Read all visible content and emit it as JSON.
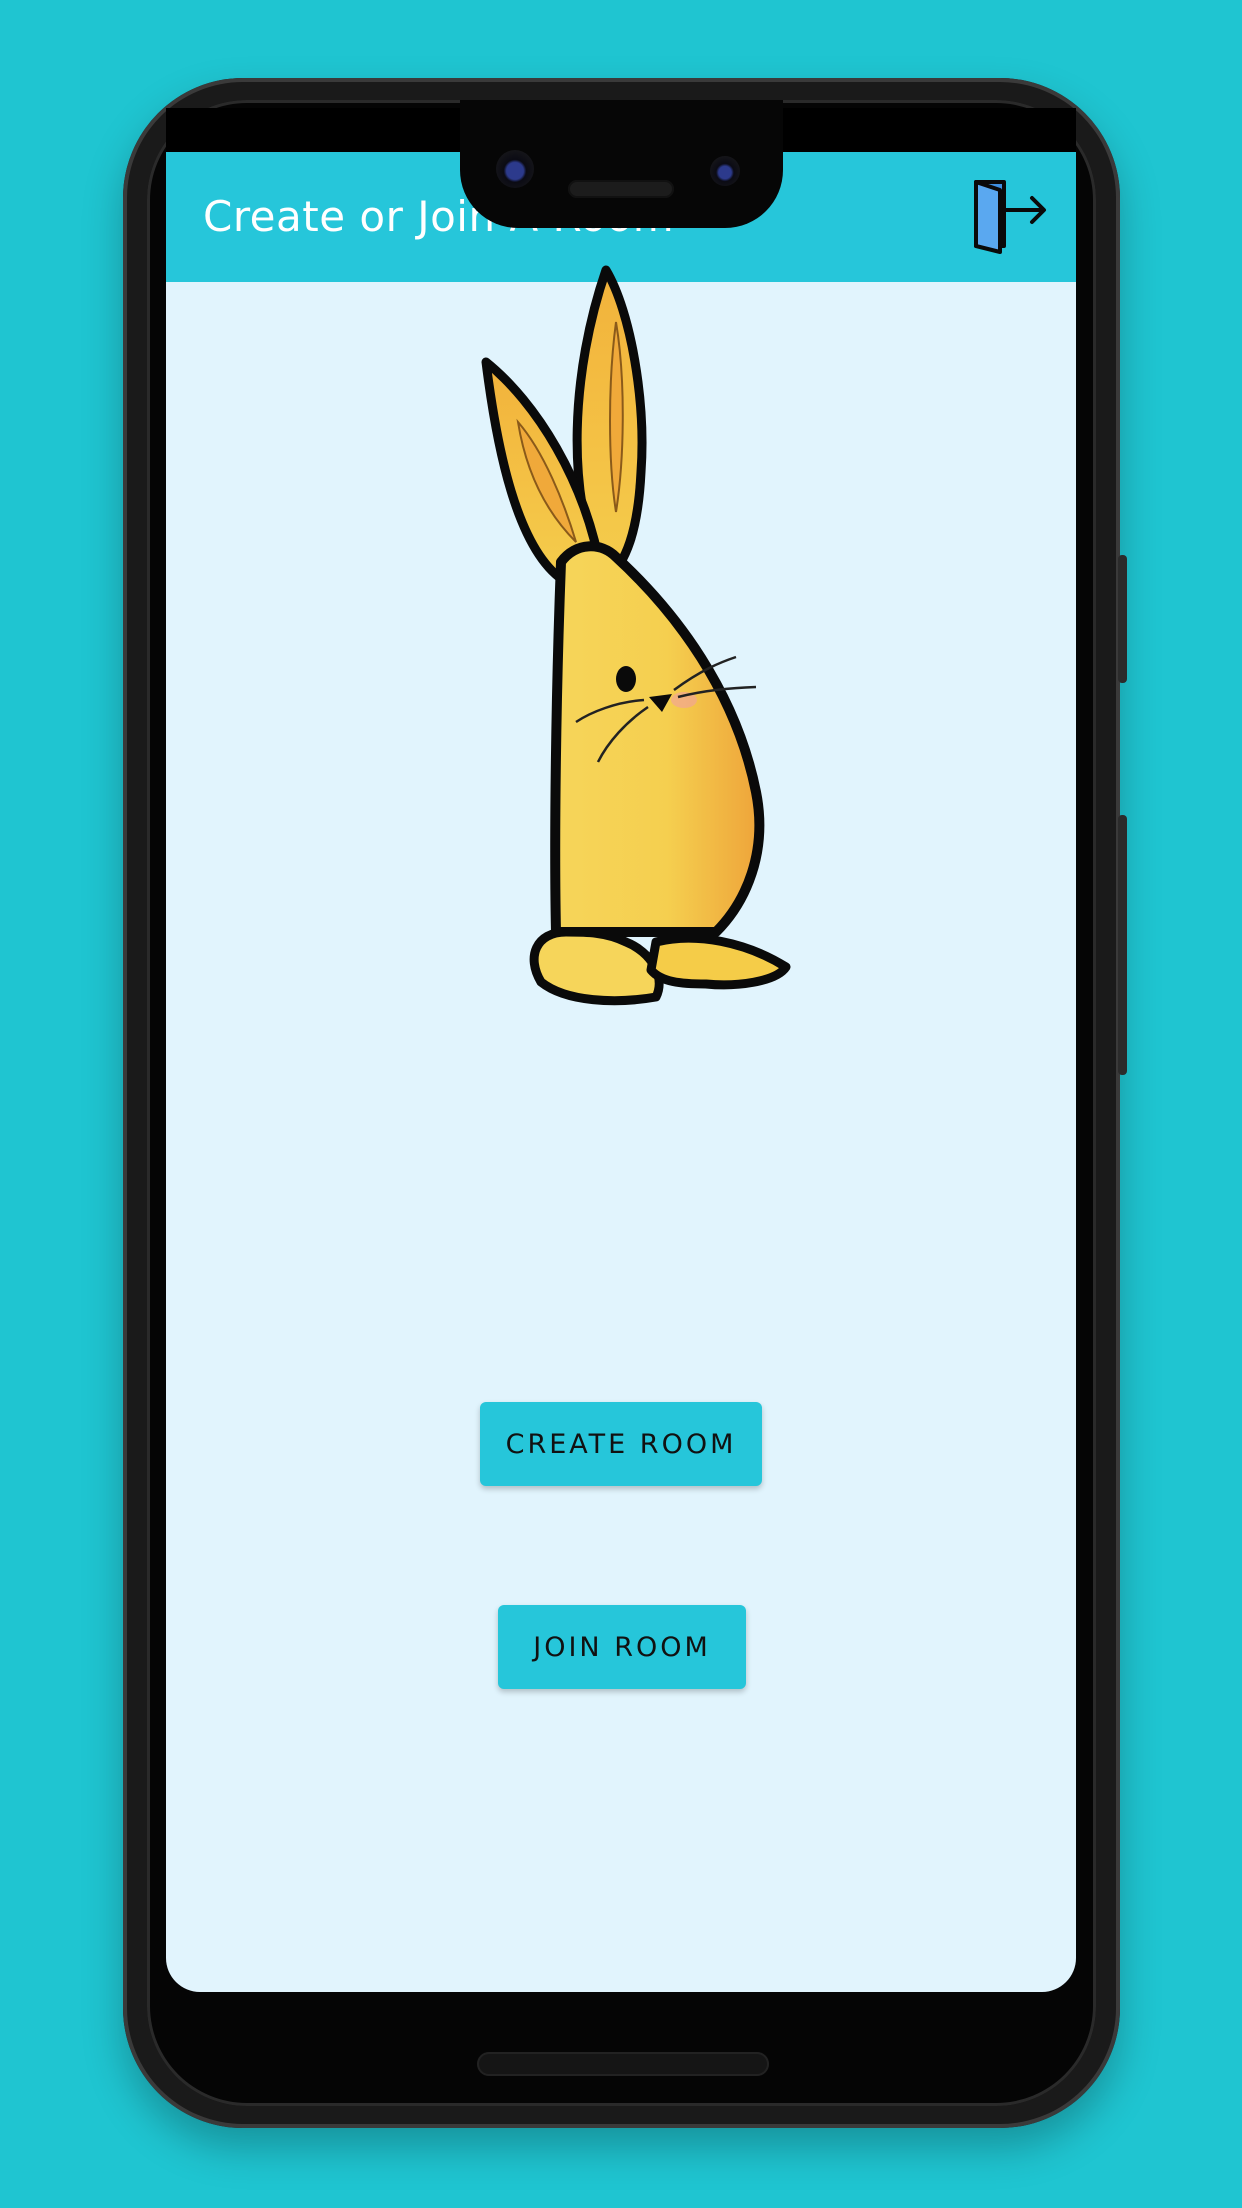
{
  "app_bar": {
    "title": "Create or Join A Room",
    "exit_icon": "exit-door-icon"
  },
  "illustration": {
    "icon": "bunny-illustration",
    "body_color": "#f5c542",
    "shade_color": "#eea43a"
  },
  "actions": {
    "create_room_label": "CREATE ROOM",
    "join_room_label": "JOIN ROOM"
  },
  "colors": {
    "background": "#1fc5d1",
    "app_bar": "#26c6da",
    "screen": "#e1f4fd",
    "button": "#26c6da"
  }
}
